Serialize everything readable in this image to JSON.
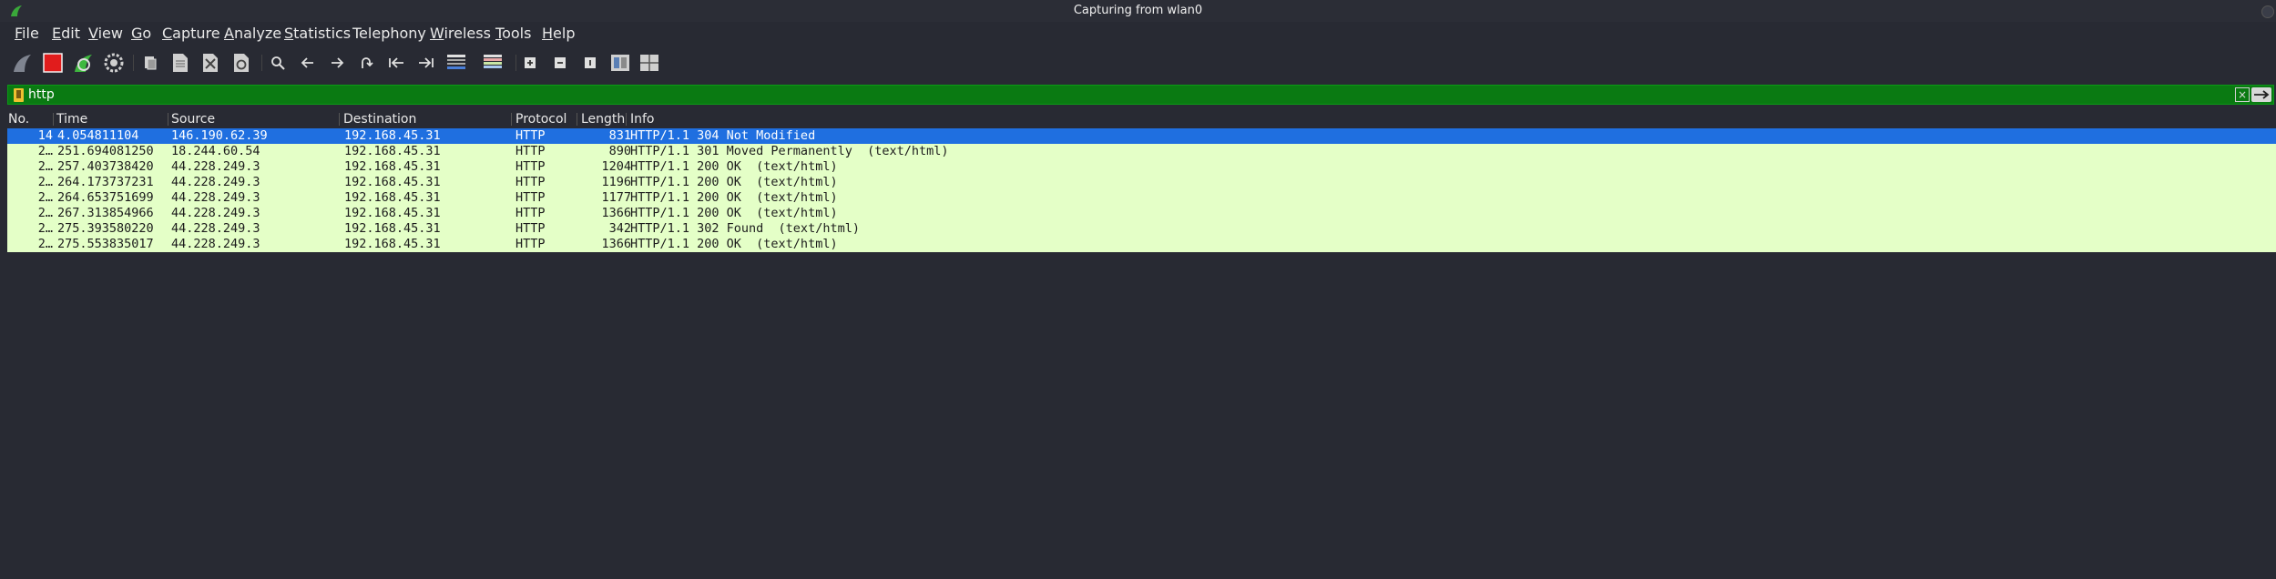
{
  "window": {
    "title": "Capturing from wlan0"
  },
  "menu": {
    "items": [
      {
        "label": "File",
        "ul": "F",
        "rest": "ile"
      },
      {
        "label": "Edit",
        "ul": "E",
        "rest": "dit"
      },
      {
        "label": "View",
        "ul": "V",
        "rest": "iew"
      },
      {
        "label": "Go",
        "ul": "G",
        "rest": "o"
      },
      {
        "label": "Capture",
        "ul": "C",
        "rest": "apture"
      },
      {
        "label": "Analyze",
        "ul": "A",
        "rest": "nalyze"
      },
      {
        "label": "Statistics",
        "ul": "S",
        "rest": "tatistics"
      },
      {
        "label": "Telephony",
        "ul": "",
        "rest": "Telephony"
      },
      {
        "label": "Wireless",
        "ul": "W",
        "rest": "ireless"
      },
      {
        "label": "Tools",
        "ul": "T",
        "rest": "ools"
      },
      {
        "label": "Help",
        "ul": "H",
        "rest": "elp"
      }
    ]
  },
  "toolbar": {
    "icons": [
      "shark-fin-icon",
      "stop-capture-icon",
      "restart-capture-icon",
      "capture-options-icon",
      "open-file-icon",
      "save-file-icon",
      "close-file-icon",
      "reload-file-icon",
      "find-packet-icon",
      "go-back-icon",
      "go-forward-icon",
      "go-to-packet-icon",
      "first-packet-icon",
      "last-packet-icon",
      "auto-scroll-icon",
      "colorize-icon",
      "zoom-in-icon",
      "zoom-out-icon",
      "normal-size-icon",
      "resize-columns-icon",
      "layout-icon"
    ]
  },
  "filter": {
    "value": "http"
  },
  "columns": {
    "no": "No.",
    "time": "Time",
    "source": "Source",
    "destination": "Destination",
    "protocol": "Protocol",
    "length": "Length",
    "info": "Info"
  },
  "packets": [
    {
      "no": "14",
      "time": "4.054811104",
      "source": "146.190.62.39",
      "destination": "192.168.45.31",
      "protocol": "HTTP",
      "length": "831",
      "info": "HTTP/1.1 304 Not Modified"
    },
    {
      "no": "2…",
      "time": "251.694081250",
      "source": "18.244.60.54",
      "destination": "192.168.45.31",
      "protocol": "HTTP",
      "length": "890",
      "info": "HTTP/1.1 301 Moved Permanently  (text/html)"
    },
    {
      "no": "2…",
      "time": "257.403738420",
      "source": "44.228.249.3",
      "destination": "192.168.45.31",
      "protocol": "HTTP",
      "length": "1204",
      "info": "HTTP/1.1 200 OK  (text/html)"
    },
    {
      "no": "2…",
      "time": "264.173737231",
      "source": "44.228.249.3",
      "destination": "192.168.45.31",
      "protocol": "HTTP",
      "length": "1196",
      "info": "HTTP/1.1 200 OK  (text/html)"
    },
    {
      "no": "2…",
      "time": "264.653751699",
      "source": "44.228.249.3",
      "destination": "192.168.45.31",
      "protocol": "HTTP",
      "length": "1177",
      "info": "HTTP/1.1 200 OK  (text/html)"
    },
    {
      "no": "2…",
      "time": "267.313854966",
      "source": "44.228.249.3",
      "destination": "192.168.45.31",
      "protocol": "HTTP",
      "length": "1366",
      "info": "HTTP/1.1 200 OK  (text/html)"
    },
    {
      "no": "2…",
      "time": "275.393580220",
      "source": "44.228.249.3",
      "destination": "192.168.45.31",
      "protocol": "HTTP",
      "length": "342",
      "info": "HTTP/1.1 302 Found  (text/html)"
    },
    {
      "no": "2…",
      "time": "275.553835017",
      "source": "44.228.249.3",
      "destination": "192.168.45.31",
      "protocol": "HTTP",
      "length": "1366",
      "info": "HTTP/1.1 200 OK  (text/html)"
    }
  ],
  "colors": {
    "row_http": "#e4ffc7",
    "row_selected": "#1f6fe0",
    "filter_valid": "#0a7a12"
  }
}
